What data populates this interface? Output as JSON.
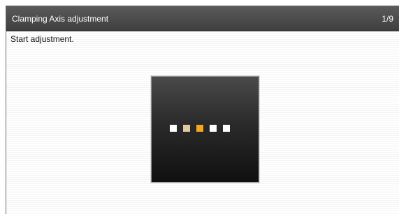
{
  "window": {
    "title": "Clamping Axis adjustment",
    "page_indicator": "1/9"
  },
  "content": {
    "instruction": "Start adjustment."
  },
  "progress_indicator": {
    "dots": [
      {
        "color": "#ffffff"
      },
      {
        "color": "#e3c9a0"
      },
      {
        "color": "#f5a623"
      },
      {
        "color": "#ffffff"
      },
      {
        "color": "#ffffff"
      }
    ]
  }
}
